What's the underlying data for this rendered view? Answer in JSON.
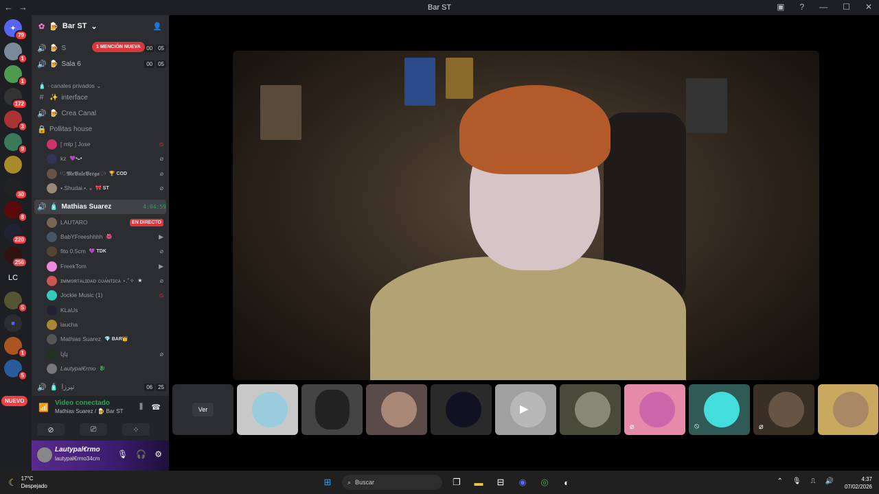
{
  "window": {
    "title": "Bar ST",
    "nav_back": "←",
    "nav_fwd": "→",
    "help": "?",
    "minimize": "—",
    "maximize": "☐",
    "close": "✕"
  },
  "servers": {
    "badges": [
      "79",
      "1",
      "1",
      "172",
      "3",
      "9",
      "",
      "",
      "30",
      "8",
      "220",
      "256",
      "",
      "5",
      "",
      "1",
      "5",
      "",
      ""
    ],
    "lc": "LC",
    "nuevo": "NUEVO"
  },
  "server_header": {
    "name": "Bar ST",
    "mention": "1 MENCIÓN NUEVA"
  },
  "channels": [
    {
      "name": "S",
      "t1": "00",
      "t2": "05"
    },
    {
      "name": "Sala 6",
      "t1": "00",
      "t2": "05"
    }
  ],
  "category": "canales privados",
  "text_channels": [
    "interface",
    "Crea Canal",
    "Pollitas house"
  ],
  "pollitas_users": [
    {
      "name": "[ mlp ] Jose",
      "tag": ""
    },
    {
      "name": "kz",
      "tag": "💜•ᴗ•"
    },
    {
      "name": "ᵎ♡𝕸𝖊𝖁𝖆𝖑𝖊𝖁𝖊𝖗𝖌𝖆♡ᵎ",
      "tag": "🏆 COD"
    },
    {
      "name": "•.Shudai.•. ⁎",
      "tag": "🎀 ST"
    }
  ],
  "active_channel": {
    "name": "Mathias Suarez",
    "timer": "4:04:59"
  },
  "active_users": [
    {
      "name": "LAUTARO",
      "tag": "",
      "live": "EN DIRECTO"
    },
    {
      "name": "BabYFreeshhhh",
      "tag": "🌺",
      "live": ""
    },
    {
      "name": "fito 0.5cm",
      "tag": "💜 TDK",
      "live": ""
    },
    {
      "name": "FreekTom",
      "tag": "",
      "live": ""
    },
    {
      "name": "ɪᴍᴍᴏʀᴛᴀʟɪᴅᴀᴅ ᴄᴜᴀ́ɴᴛɪᴄᴀ ⋆.˚✧",
      "tag": "★",
      "live": ""
    },
    {
      "name": "Jockie Music (1)",
      "tag": "",
      "live": ""
    },
    {
      "name": "KLaUs",
      "tag": "",
      "live": ""
    },
    {
      "name": "laucha",
      "tag": "",
      "live": ""
    },
    {
      "name": "Mathias Suarez",
      "tag": "💎 BAR👑",
      "live": ""
    },
    {
      "name": "կկ",
      "tag": "",
      "live": ""
    },
    {
      "name": "Lautypal€rmo",
      "tag": "🐉",
      "live": ""
    }
  ],
  "last_channel": {
    "name": "تيرزا",
    "t1": "06",
    "t2": "25"
  },
  "voice": {
    "title": "Video conectado",
    "sub": "Mathias Suarez / 🍺 Bar ST"
  },
  "user": {
    "name": "Lautypal€rmo",
    "sub": "lautypal€rmo34cm"
  },
  "stage": {
    "ver": "Ver"
  },
  "taskbar": {
    "temp": "17°C",
    "weather": "Despejado",
    "search": "Buscar",
    "time": "4:37",
    "date": "07/02/2026"
  },
  "colors": {
    "accent": "#5865f2",
    "green": "#23a55a",
    "red": "#da373c"
  }
}
